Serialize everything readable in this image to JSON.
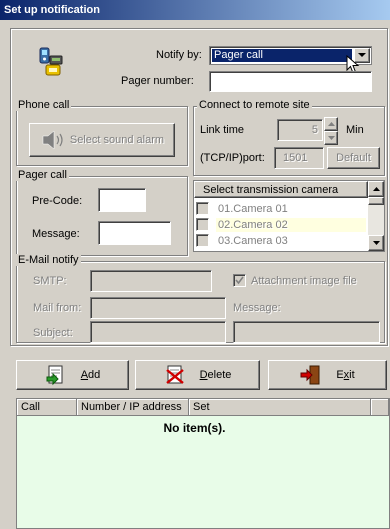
{
  "window": {
    "title": "Set up notification"
  },
  "notify": {
    "label": "Notify by:",
    "value": "Pager call",
    "pager_number_label": "Pager number:",
    "pager_number_value": ""
  },
  "phone_call": {
    "group_label": "Phone call",
    "sound_button": "Select sound alarm"
  },
  "remote": {
    "group_label": "Connect to remote site",
    "link_time_label": "Link time",
    "link_time_value": "5",
    "link_time_unit": "Min",
    "port_label": "(TCP/IP)port:",
    "port_value": "1501",
    "default_button": "Default"
  },
  "pager_call": {
    "group_label": "Pager call",
    "precode_label": "Pre-Code:",
    "precode_value": "",
    "message_label": "Message:",
    "message_value": ""
  },
  "camera_list": {
    "header": "Select transmission camera",
    "items": [
      {
        "label": "01.Camera 01",
        "checked": false,
        "highlight": false
      },
      {
        "label": "02.Camera 02",
        "checked": false,
        "highlight": true
      },
      {
        "label": "03.Camera 03",
        "checked": false,
        "highlight": false
      }
    ]
  },
  "email": {
    "group_label": "E-Mail notify",
    "smtp_label": "SMTP:",
    "attachment_label": "Attachment image file",
    "attachment_checked": true,
    "mail_from_label": "Mail from:",
    "message_label": "Message:",
    "subject_label": "Subject:"
  },
  "actions": {
    "add": "Add",
    "add_hotkey": "A",
    "delete": "Delete",
    "delete_hotkey": "D",
    "exit": "Exit",
    "exit_hotkey": "x"
  },
  "table": {
    "columns": [
      "Call",
      "Number / IP address",
      "Set"
    ],
    "empty_message": "No item(s)."
  },
  "colors": {
    "titlebar": "#0a246a",
    "selection": "#0a246a",
    "list_background": "#e8fce8",
    "camera_highlight": "#ffffe0"
  },
  "icons": {
    "device": "pager-device-icon",
    "speaker": "speaker-icon",
    "add": "add-document-icon",
    "delete": "delete-document-icon",
    "exit": "exit-door-icon"
  }
}
